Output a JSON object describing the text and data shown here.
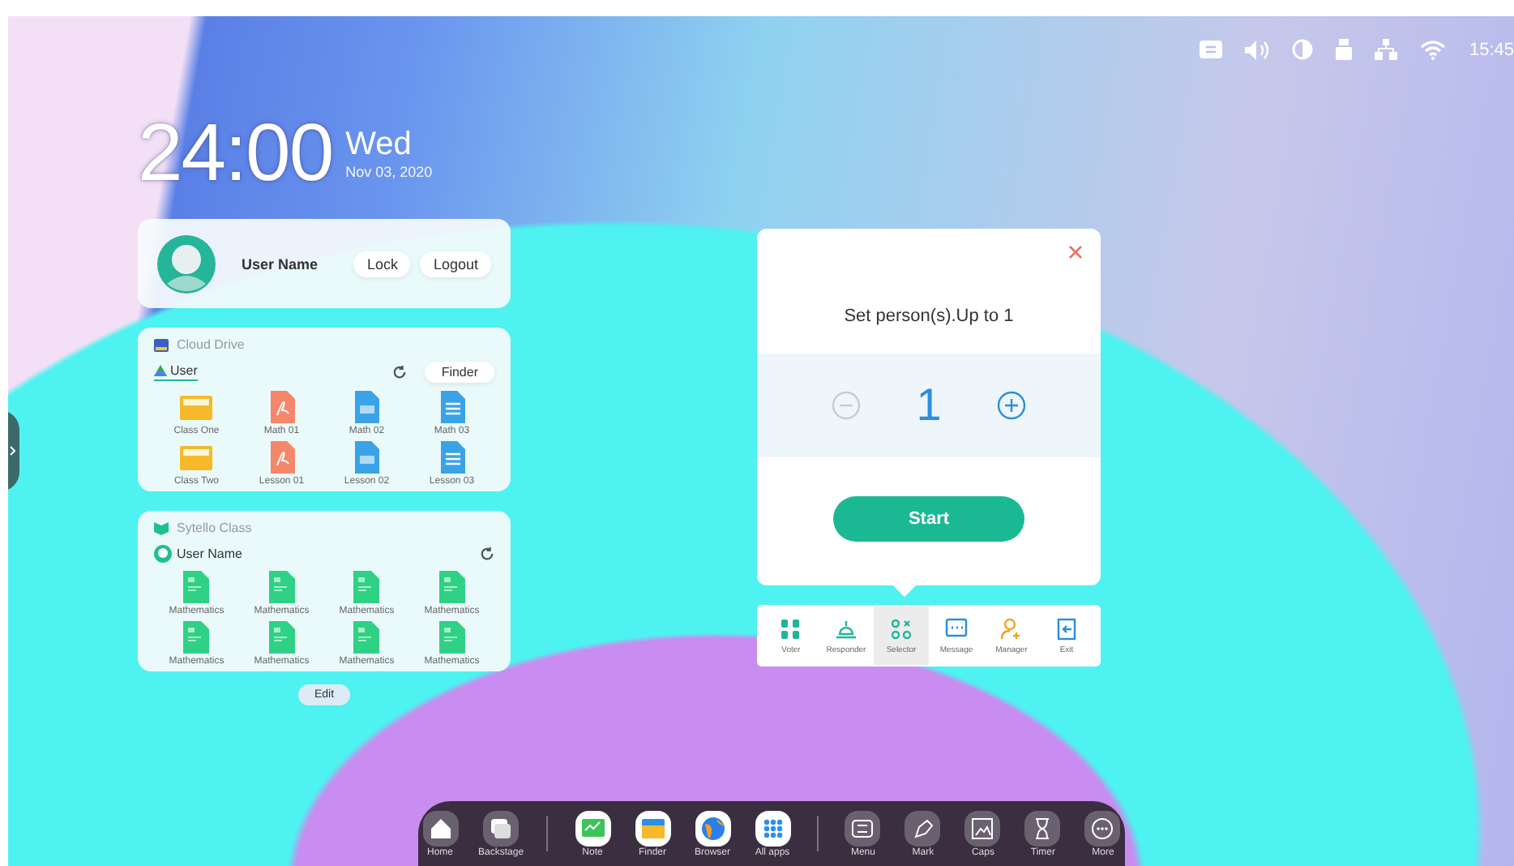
{
  "status_bar": {
    "time": "15:45"
  },
  "clock": {
    "time": "24:00",
    "weekday": "Wed",
    "date": "Nov 03,  2020"
  },
  "user_card": {
    "name": "User Name",
    "buttons": [
      "Lock",
      "Logout"
    ]
  },
  "cloud_drive": {
    "title": "Cloud Drive",
    "tab": {
      "label": "User",
      "selected": true
    },
    "button": "Finder",
    "files": [
      {
        "name": "Class One",
        "kind": "folder"
      },
      {
        "name": "Math 01",
        "kind": "pdf"
      },
      {
        "name": "Math 02",
        "kind": "doc"
      },
      {
        "name": "Math 03",
        "kind": "text"
      },
      {
        "name": "Class Two",
        "kind": "folder"
      },
      {
        "name": "Lesson 01",
        "kind": "pdf"
      },
      {
        "name": "Lesson 02",
        "kind": "doc"
      },
      {
        "name": "Lesson 03",
        "kind": "text"
      }
    ]
  },
  "class_card": {
    "title": "Sytello Class",
    "user": "User Name",
    "files": [
      {
        "name": "Mathematics",
        "kind": "sheet"
      },
      {
        "name": "Mathematics",
        "kind": "sheet"
      },
      {
        "name": "Mathematics",
        "kind": "sheet"
      },
      {
        "name": "Mathematics",
        "kind": "sheet"
      },
      {
        "name": "Mathematics",
        "kind": "sheet"
      },
      {
        "name": "Mathematics",
        "kind": "sheet"
      },
      {
        "name": "Mathematics",
        "kind": "sheet"
      },
      {
        "name": "Mathematics",
        "kind": "sheet"
      }
    ]
  },
  "edit_button": "Edit",
  "dialog": {
    "title": "Set person(s).Up to 1",
    "count": "1",
    "minus_disabled": true,
    "button": "Start"
  },
  "tools": [
    {
      "label": "Voter",
      "kind": "voter",
      "selected": false
    },
    {
      "label": "Responder",
      "kind": "responder",
      "selected": false
    },
    {
      "label": "Selector",
      "kind": "selector",
      "selected": true
    },
    {
      "label": "Message",
      "kind": "message",
      "selected": false
    },
    {
      "label": "Manager",
      "kind": "manager",
      "selected": false
    },
    {
      "label": "Exit",
      "kind": "exit",
      "selected": false
    }
  ],
  "dock": {
    "groups": [
      [
        {
          "label": "Home",
          "kind": "home"
        },
        {
          "label": "Backstage",
          "kind": "backstage"
        }
      ],
      [
        {
          "label": "Note",
          "kind": "note"
        },
        {
          "label": "Finder",
          "kind": "finder"
        },
        {
          "label": "Browser",
          "kind": "browser"
        },
        {
          "label": "All apps",
          "kind": "apps"
        }
      ],
      [
        {
          "label": "Menu",
          "kind": "menu"
        },
        {
          "label": "Mark",
          "kind": "mark"
        },
        {
          "label": "Caps",
          "kind": "caps"
        },
        {
          "label": "Timer",
          "kind": "timer"
        },
        {
          "label": "More",
          "kind": "more"
        }
      ]
    ]
  }
}
